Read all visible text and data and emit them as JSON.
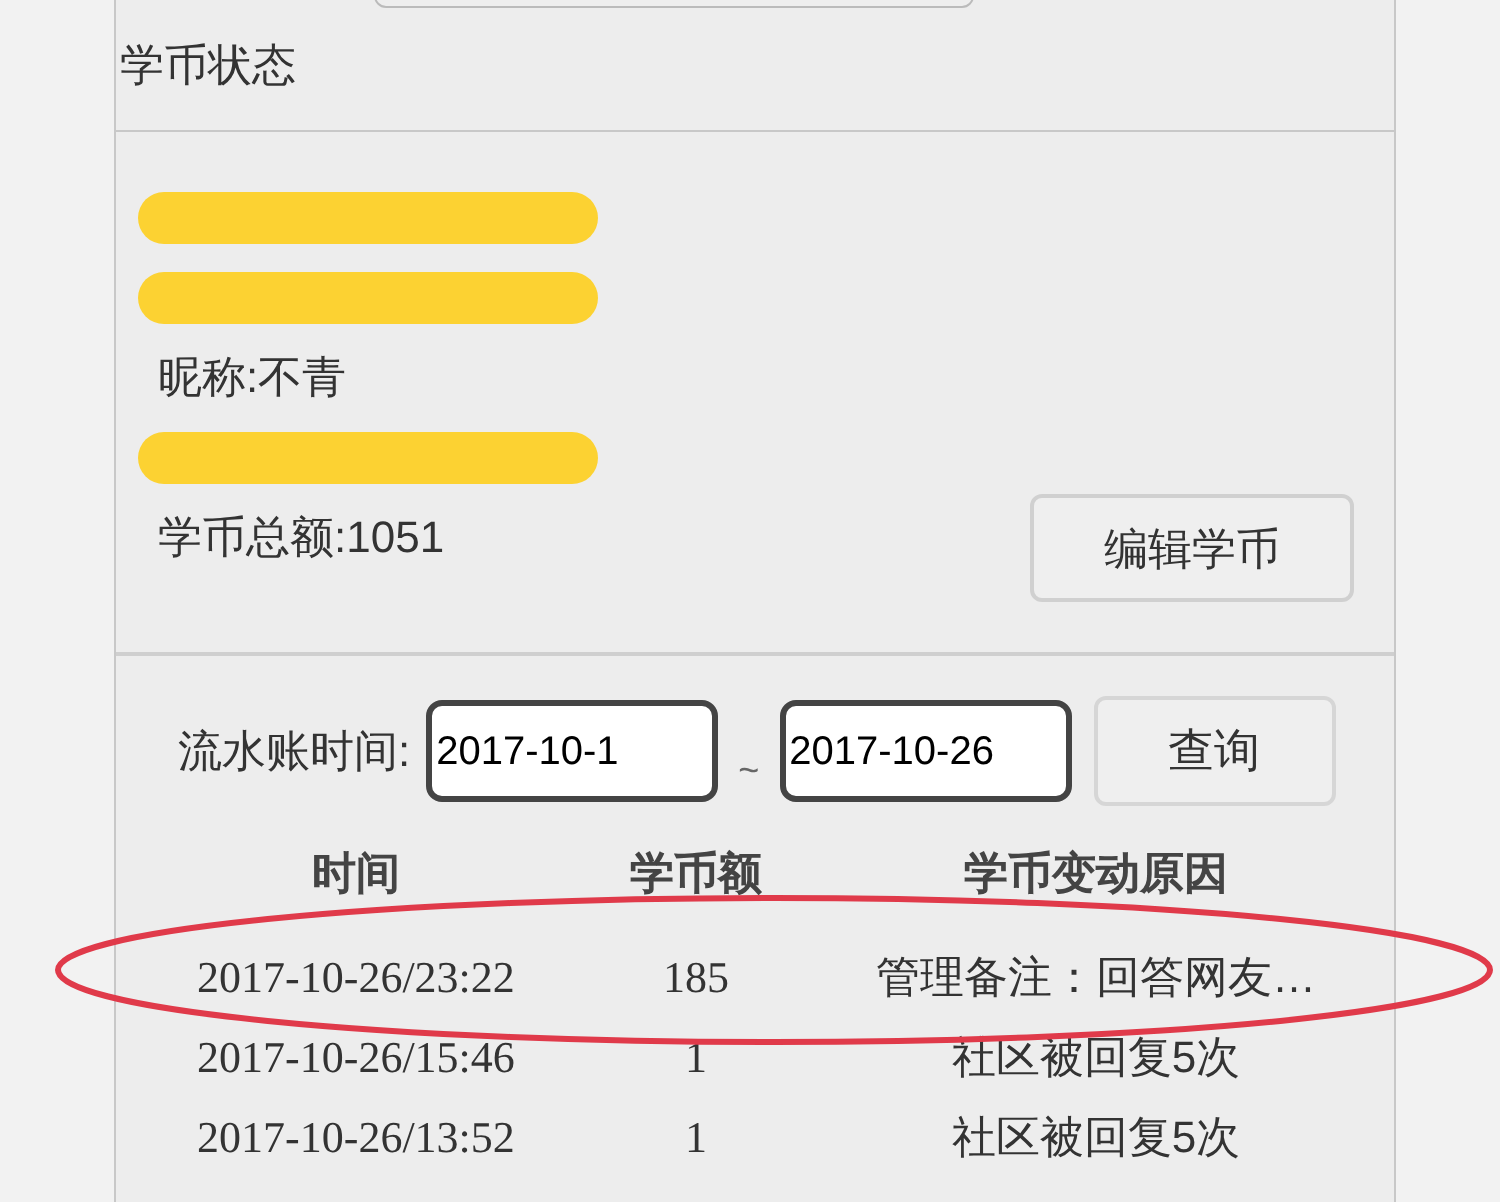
{
  "panel_title": "学币状态",
  "profile": {
    "lines": [
      {
        "kind": "hidden"
      },
      {
        "kind": "hidden"
      },
      {
        "kind": "text",
        "text": "昵称:不青"
      },
      {
        "kind": "hidden"
      },
      {
        "kind": "text",
        "text": "学币总额:1051"
      }
    ],
    "edit_button": "编辑学币"
  },
  "ledger_filter": {
    "label": "流水账时间:",
    "from": "2017-10-1",
    "separator": "~",
    "to": "2017-10-26",
    "query_button": "查询"
  },
  "table": {
    "columns": [
      "时间",
      "学币额",
      "学币变动原因"
    ],
    "rows": [
      {
        "time": "2017-10-26/23:22",
        "amount": "185",
        "reason": "管理备注：回答网友…"
      },
      {
        "time": "2017-10-26/15:46",
        "amount": "1",
        "reason": "社区被回复5次"
      },
      {
        "time": "2017-10-26/13:52",
        "amount": "1",
        "reason": "社区被回复5次"
      }
    ]
  }
}
